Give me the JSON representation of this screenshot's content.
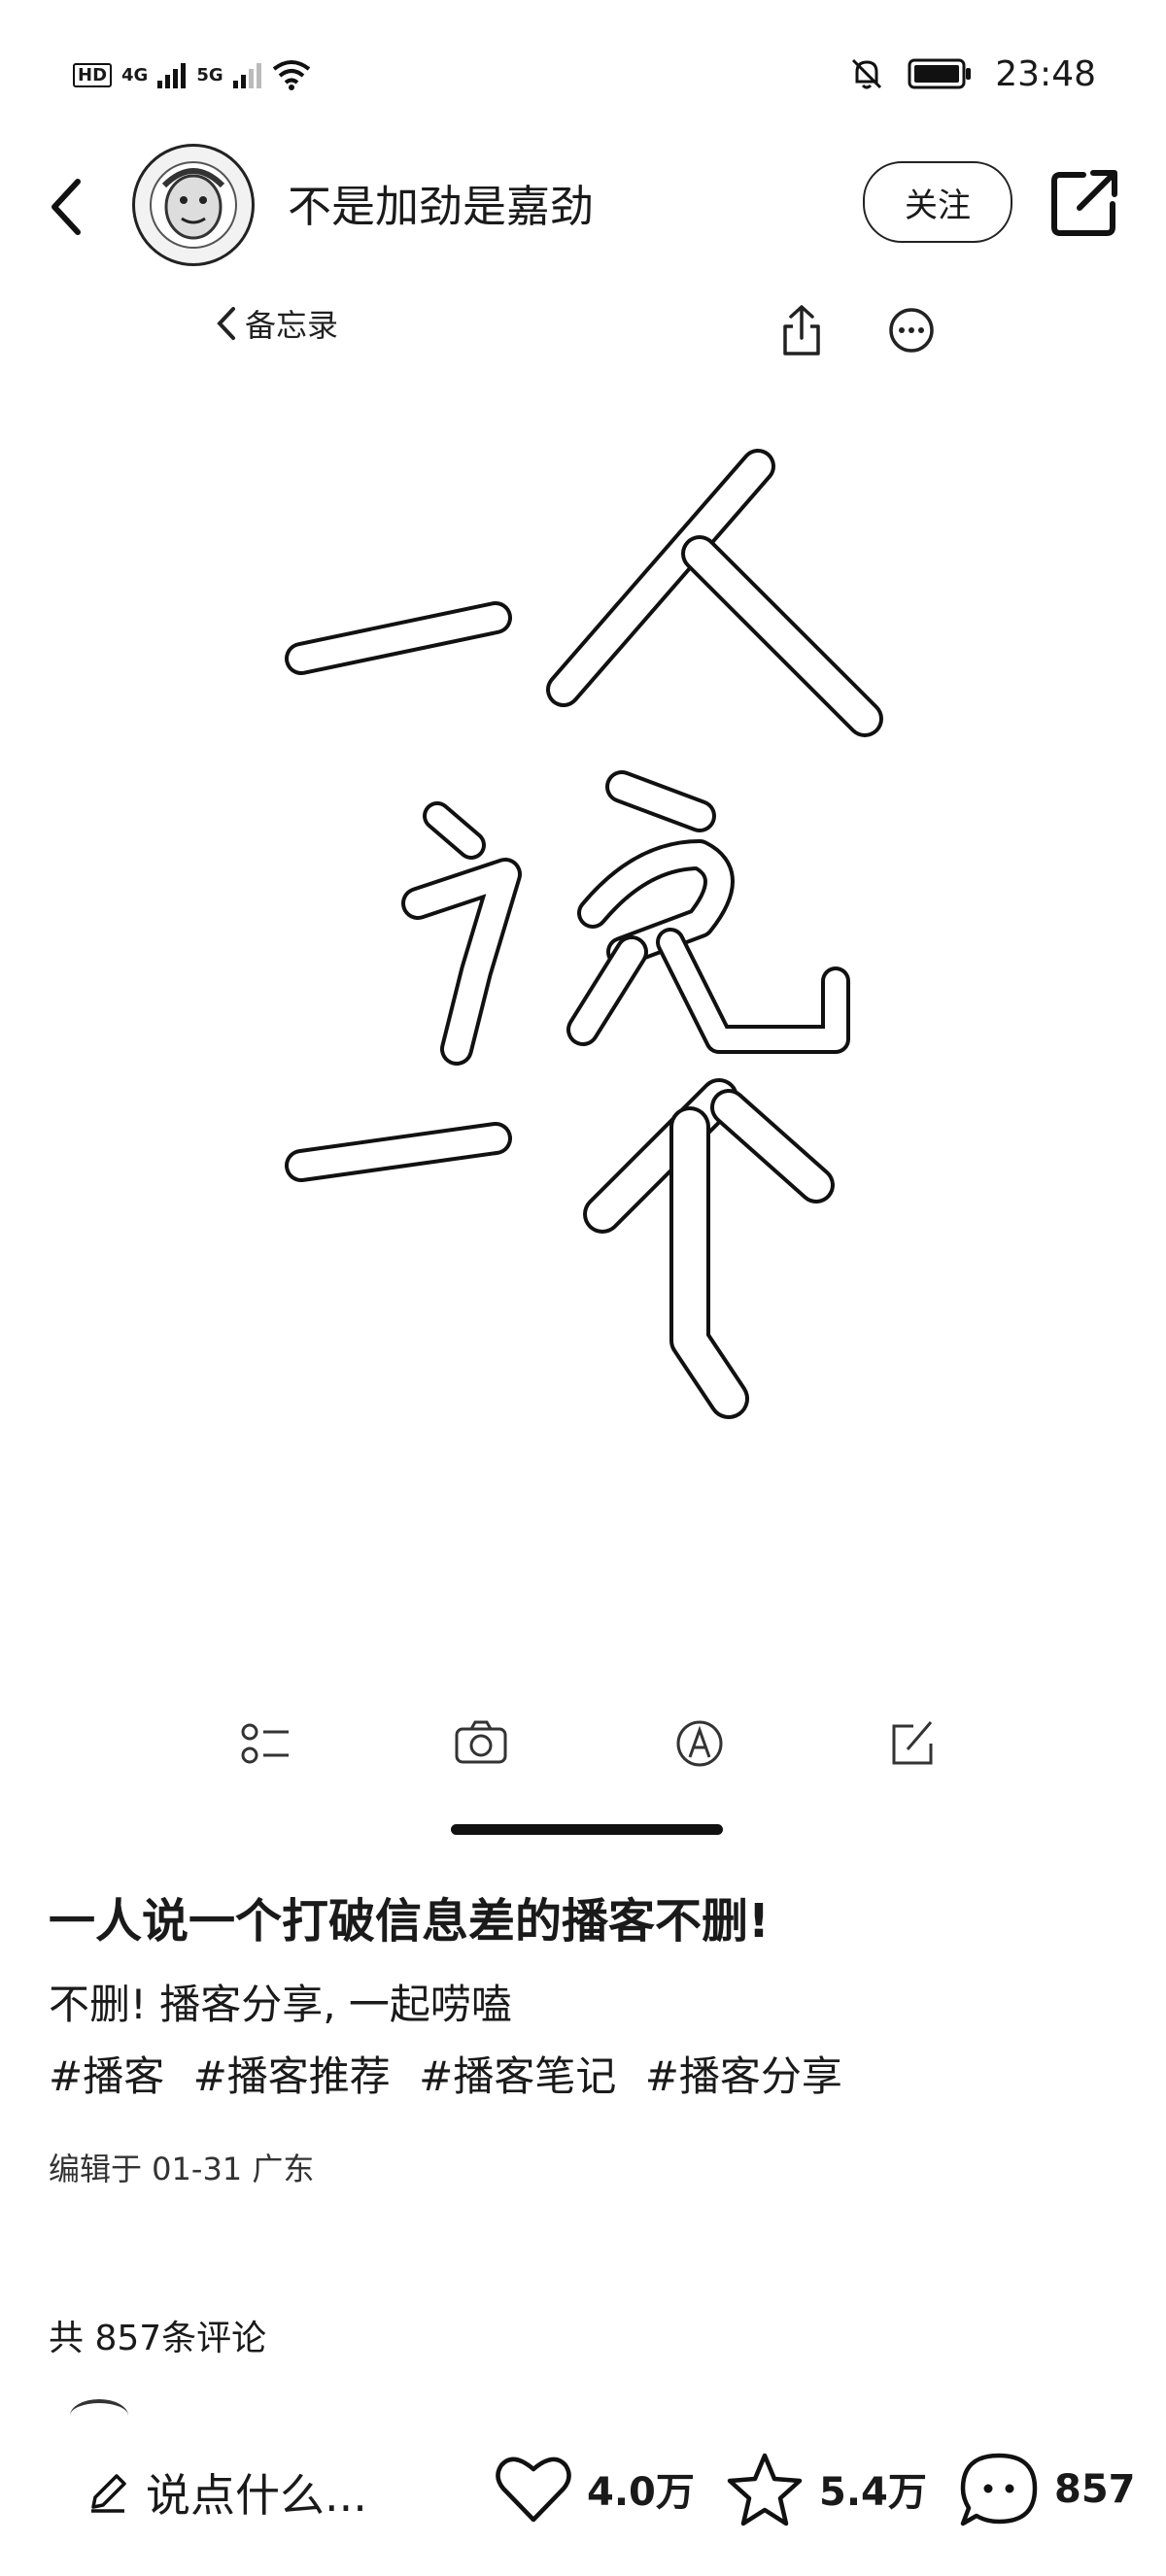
{
  "status_bar": {
    "hd": "HD",
    "net1": "4G",
    "net2": "5G",
    "time": "23:48"
  },
  "header": {
    "author": "不是加劲是嘉劲",
    "follow_label": "关注"
  },
  "memo": {
    "back_label": "备忘录"
  },
  "post": {
    "title": "一人说一个打破信息差的播客不删!",
    "description": "不删! 播客分享, 一起唠嗑",
    "tags": [
      "#播客",
      "#播客推荐",
      "#播客笔记",
      "#播客分享"
    ],
    "edited": "编辑于 01-31 广东",
    "comments_total": "共 857条评论"
  },
  "bottom_bar": {
    "input_placeholder": "说点什么...",
    "likes": "4.0万",
    "favorites": "5.4万",
    "comments": "857"
  },
  "icons": {
    "back": "chevron-left-icon",
    "share_external": "share-external-icon",
    "memo_share": "upload-share-icon",
    "memo_more": "more-icon",
    "checklist": "checklist-icon",
    "camera": "camera-icon",
    "handwriting": "handwriting-icon",
    "edit": "edit-icon",
    "pencil": "pencil-icon",
    "heart": "heart-icon",
    "star": "star-icon",
    "comment": "comment-icon"
  }
}
